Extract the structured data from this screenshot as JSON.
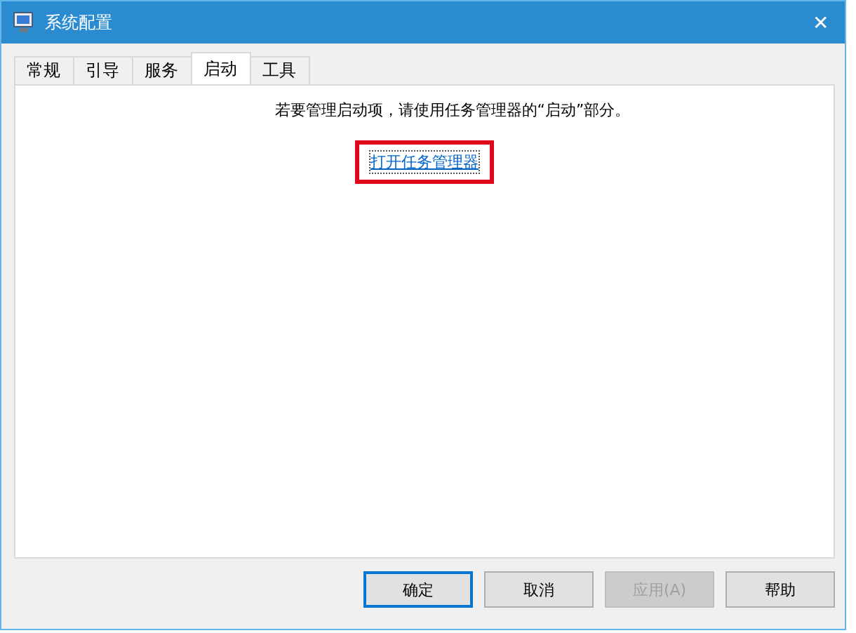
{
  "window": {
    "title": "系统配置",
    "close": "✕"
  },
  "tabs": [
    {
      "label": "常规",
      "selected": false
    },
    {
      "label": "引导",
      "selected": false
    },
    {
      "label": "服务",
      "selected": false
    },
    {
      "label": "启动",
      "selected": true
    },
    {
      "label": "工具",
      "selected": false
    }
  ],
  "startup": {
    "message": "若要管理启动项，请使用任务管理器的“启动”部分。",
    "link": {
      "label": "打开任务管理器",
      "highlighted": true
    }
  },
  "buttons": [
    {
      "label": "确定",
      "default": true,
      "disabled": false
    },
    {
      "label": "取消",
      "default": false,
      "disabled": false
    },
    {
      "label": "应用(A)",
      "default": false,
      "disabled": true
    },
    {
      "label": "帮助",
      "default": false,
      "disabled": false
    }
  ]
}
